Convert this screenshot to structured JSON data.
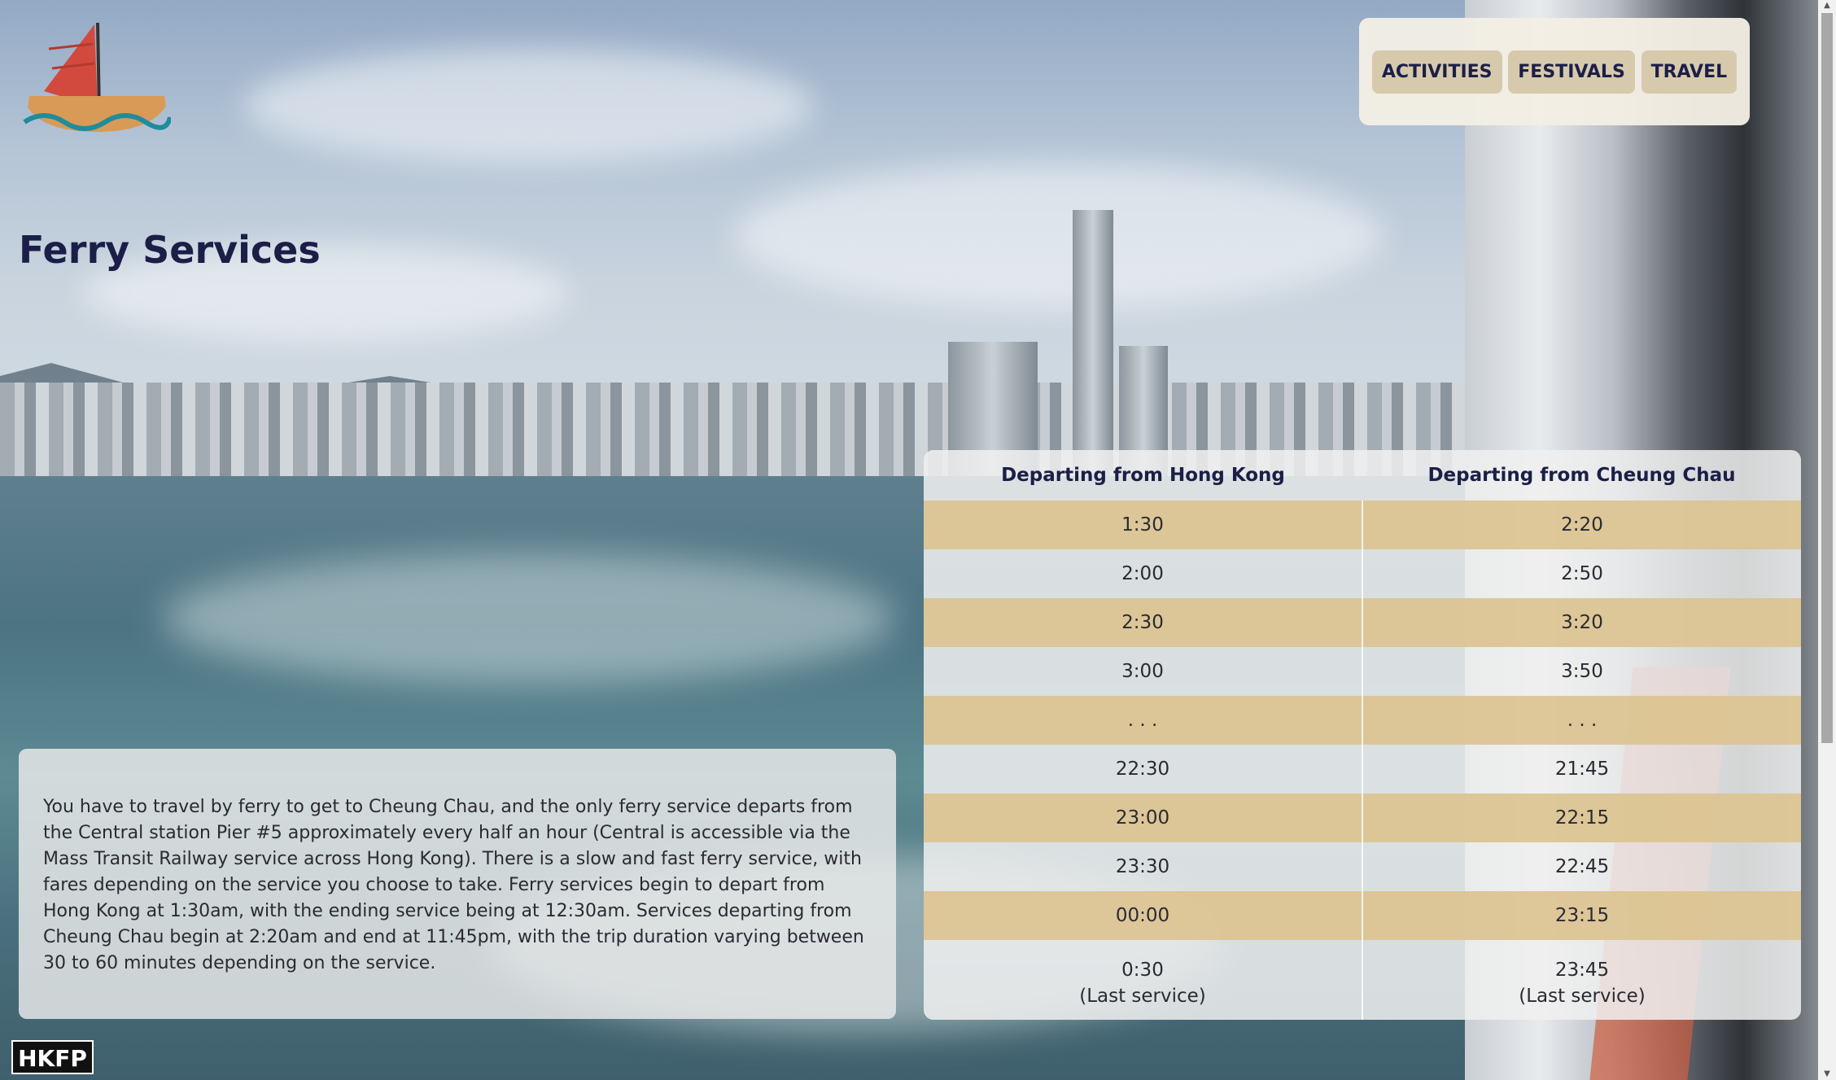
{
  "page": {
    "title": "Ferry Services"
  },
  "nav": {
    "items": [
      {
        "label": "ACTIVITIES"
      },
      {
        "label": "FESTIVALS"
      },
      {
        "label": "TRAVEL"
      }
    ]
  },
  "info": {
    "text": "You have to travel by ferry to get to Cheung Chau, and the only ferry service departs from the Central station Pier #5 approximately every half an hour (Central is accessible via the Mass Transit Railway service across Hong Kong). There is a slow and fast ferry service, with fares depending on the service you choose to take. Ferry services begin to depart from Hong Kong at 1:30am, with the ending service being at 12:30am. Services departing from Cheung Chau begin at 2:20am and end at 11:45pm, with the trip duration varying between 30 to 60 minutes depending on the service."
  },
  "schedule": {
    "headers": [
      "Departing from Hong Kong",
      "Departing from Cheung Chau"
    ],
    "rows": [
      [
        "1:30",
        "2:20"
      ],
      [
        "2:00",
        "2:50"
      ],
      [
        "2:30",
        "3:20"
      ],
      [
        "3:00",
        "3:50"
      ],
      [
        ". . .",
        ". . ."
      ],
      [
        "22:30",
        "21:45"
      ],
      [
        "23:00",
        "22:15"
      ],
      [
        "23:30",
        "22:45"
      ],
      [
        "00:00",
        "23:15"
      ]
    ],
    "last_row": {
      "hk_time": "0:30",
      "cc_time": "23:45",
      "note": "(Last service)"
    }
  },
  "watermark": {
    "text": "HKFP"
  },
  "colors": {
    "accent": "#d7c9ac",
    "row_alt": "#dcc492",
    "title": "#1b1f47"
  },
  "icons": {
    "logo": "boat-logo-icon"
  }
}
